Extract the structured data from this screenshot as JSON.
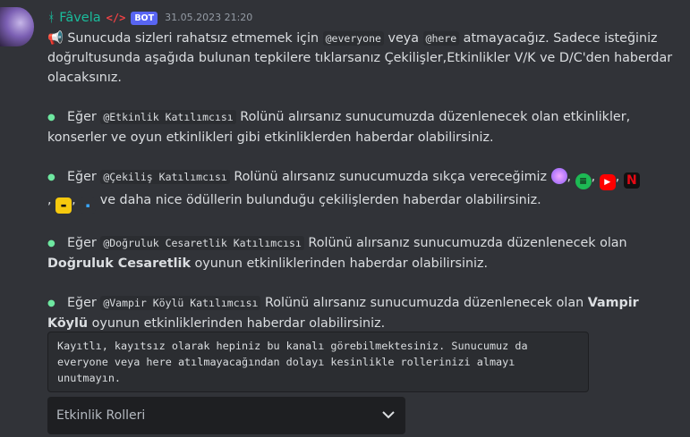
{
  "message": {
    "username": "ᚼ Fâvela",
    "dev_badge": "</>",
    "bot_badge": "BOT",
    "timestamp": "31.05.2023 21:20",
    "intro": {
      "icon": "megaphone-icon",
      "text1": " Sunucuda sizleri rahatsız etmemek için ",
      "code1": "@everyone",
      "text2": " veya ",
      "code2": "@here",
      "text3": " atmayacağız. Sadece isteğiniz doğrultusunda aşağıda bulunan tepkilere tıklarsanız Çekilişler,Etkinlikler V/K ve D/C'den haberdar olacaksınız."
    },
    "items": [
      {
        "prefix": "Eğer ",
        "role": "@Etkinlik Katılımcısı",
        "text": " Rolünü alırsanız sunucumuzda düzenlenecek olan etkinlikler, konserler ve oyun etkinlikleri gibi etkinliklerden haberdar olabilirsiniz."
      },
      {
        "prefix": "Eğer ",
        "role": "@Çekiliş Katılımcısı",
        "text_before_emojis": " Rolünü alırsanız sunucumuzda sıkça vereceğimiz ",
        "separator": ",",
        "emojis": [
          "nitro-icon",
          "spotify-icon",
          "youtube-icon",
          "netflix-icon",
          "exxen-icon",
          "blutv-icon"
        ],
        "text_after": " ve daha nice ödüllerin bulunduğu çekilişlerden haberdar olabilirsiniz."
      },
      {
        "prefix": "Eğer ",
        "role": "@Doğruluk Cesaretlik Katılımcısı",
        "text": " Rolünü alırsanız sunucumuzda düzenlenecek olan ",
        "bold": "Doğruluk Cesaretlik",
        "text2": " oyunun etkinliklerinden haberdar olabilirsiniz."
      },
      {
        "prefix": "Eğer ",
        "role": "@Vampir Köylü Katılımcısı",
        "text": " Rolünü alırsanız sunucumuzda düzenlenecek olan ",
        "bold": "Vampir Köylü",
        "text2": " oyunun etkinliklerinden haberdar olabilirsiniz."
      }
    ],
    "codeblock": "Kayıtlı, kayıtsız olarak hepiniz bu kanalı görebilmektesiniz. Sunucumuz da\neveryone veya here atılmayacağından dolayı kesinlikle rollerinizi almayı\nunutmayın.",
    "select": {
      "placeholder": "Etkinlik Rolleri"
    }
  },
  "colors": {
    "background": "#313338",
    "username": "#1abc9c",
    "bot_badge": "#5865f2",
    "bullet": "#6ee7a0"
  }
}
